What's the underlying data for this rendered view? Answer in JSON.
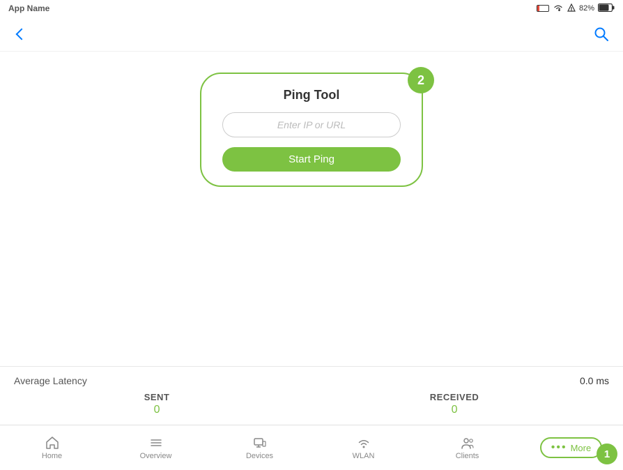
{
  "app": {
    "name": "Ping Tool"
  },
  "status_bar": {
    "carrier": "App Name",
    "battery_percent": "82%",
    "battery_level": 82
  },
  "header": {
    "title": "Ping Tool",
    "back_label": "Back",
    "search_label": "Search"
  },
  "ping_tool": {
    "title": "Ping Tool",
    "input_placeholder": "Enter IP or URL",
    "input_value": "",
    "start_button_label": "Start Ping",
    "badge_number": "2"
  },
  "stats": {
    "avg_latency_label": "Average Latency",
    "avg_latency_value": "0.0 ms",
    "sent_label": "SENT",
    "sent_value": "0",
    "received_label": "RECEIVED",
    "received_value": "0"
  },
  "nav": {
    "items": [
      {
        "id": "home",
        "label": "Home",
        "icon": "home"
      },
      {
        "id": "overview",
        "label": "Overview",
        "icon": "menu"
      },
      {
        "id": "devices",
        "label": "Devices",
        "icon": "devices"
      },
      {
        "id": "wlan",
        "label": "WLAN",
        "icon": "wifi"
      },
      {
        "id": "clients",
        "label": "Clients",
        "icon": "clients"
      }
    ],
    "more_label": "More",
    "more_dots": "•••",
    "badge_number": "1"
  }
}
